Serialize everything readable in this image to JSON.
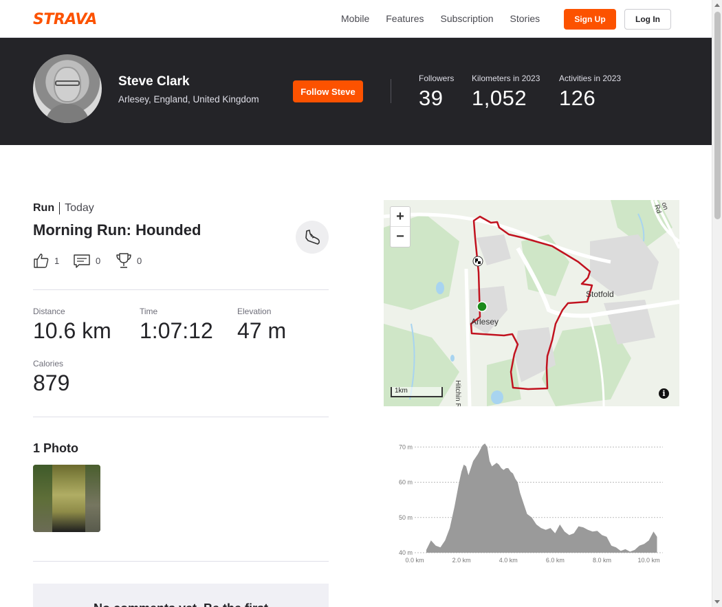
{
  "nav": {
    "logo": "STRAVA",
    "links": [
      "Mobile",
      "Features",
      "Subscription",
      "Stories"
    ],
    "signup": "Sign Up",
    "login": "Log In"
  },
  "athlete": {
    "name": "Steve Clark",
    "location": "Arlesey, England, United Kingdom",
    "follow": "Follow Steve",
    "stats": [
      {
        "label": "Followers",
        "value": "39"
      },
      {
        "label": "Kilometers in 2023",
        "value": "1,052"
      },
      {
        "label": "Activities in 2023",
        "value": "126"
      }
    ]
  },
  "activity": {
    "type": "Run",
    "when": "Today",
    "title": "Morning Run: Hounded",
    "kudos": "1",
    "comments": "0",
    "achievements": "0",
    "stats": [
      {
        "label": "Distance",
        "value": "10.6 km"
      },
      {
        "label": "Time",
        "value": "1:07:12"
      },
      {
        "label": "Elevation",
        "value": "47 m"
      },
      {
        "label": "Calories",
        "value": "879"
      }
    ],
    "photos_heading": "1 Photo",
    "comments_empty": "No comments yet. Be the first"
  },
  "map": {
    "zoom_in": "+",
    "zoom_out": "−",
    "scale_label": "1km",
    "labels": {
      "town1": "Arlesey",
      "town2": "Stotfold",
      "road1": "Hitchin R",
      "road2": "on Rd"
    },
    "info": "i",
    "route_color": "#c1121f",
    "start_color": "#1a8a1a"
  },
  "chart_data": {
    "type": "area",
    "title": "",
    "xlabel": "",
    "ylabel": "",
    "xlim": [
      0,
      10.6
    ],
    "ylim": [
      40,
      72
    ],
    "x_ticks": [
      "0.0 km",
      "2.0 km",
      "4.0 km",
      "6.0 km",
      "8.0 km",
      "10.0 km"
    ],
    "y_ticks": [
      "40 m",
      "50 m",
      "60 m",
      "70 m"
    ],
    "x": [
      0.5,
      0.7,
      0.9,
      1.1,
      1.3,
      1.5,
      1.7,
      1.9,
      2.0,
      2.1,
      2.2,
      2.3,
      2.5,
      2.7,
      2.9,
      3.0,
      3.1,
      3.2,
      3.3,
      3.4,
      3.5,
      3.6,
      3.7,
      3.8,
      3.9,
      4.0,
      4.1,
      4.2,
      4.3,
      4.4,
      4.5,
      4.6,
      4.7,
      4.8,
      5.0,
      5.2,
      5.4,
      5.6,
      5.8,
      6.0,
      6.2,
      6.4,
      6.6,
      6.8,
      7.0,
      7.2,
      7.4,
      7.6,
      7.8,
      8.0,
      8.2,
      8.4,
      8.6,
      8.8,
      9.0,
      9.2,
      9.4,
      9.6,
      9.8,
      10.0,
      10.2,
      10.35
    ],
    "y": [
      40.8,
      43.5,
      42.0,
      41.5,
      43.5,
      47.0,
      53.0,
      60.0,
      63.0,
      65.0,
      64.5,
      62.0,
      66.0,
      68.0,
      70.5,
      71.0,
      70.0,
      66.0,
      64.5,
      65.0,
      65.5,
      65.0,
      64.0,
      63.5,
      64.0,
      64.0,
      63.0,
      62.5,
      61.0,
      60.0,
      57.0,
      55.0,
      53.0,
      51.0,
      50.0,
      48.0,
      47.0,
      46.5,
      47.0,
      45.5,
      48.0,
      46.0,
      45.0,
      45.5,
      47.5,
      47.2,
      46.5,
      46.0,
      46.2,
      45.0,
      44.5,
      42.0,
      41.5,
      40.5,
      41.0,
      40.3,
      40.8,
      42.0,
      42.5,
      43.5,
      46.0,
      44.5
    ],
    "fill_color": "#9a9a9a"
  }
}
